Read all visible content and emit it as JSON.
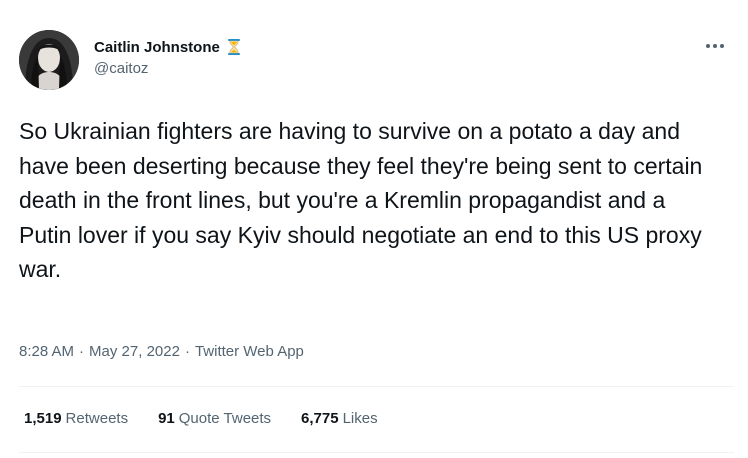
{
  "author": {
    "display_name": "Caitlin Johnstone",
    "handle": "@caitoz",
    "name_emoji": "hourglass-icon"
  },
  "tweet": {
    "text": "So Ukrainian fighters are having to survive on a potato a day and have been deserting because they feel they're being sent to certain death in the front lines, but you're a Kremlin propagandist and a Putin lover if you say Kyiv should negotiate an end to this US proxy war.",
    "time": "8:28 AM",
    "date": "May 27, 2022",
    "source": "Twitter Web App",
    "separator": "·"
  },
  "stats": {
    "retweets_count": "1,519",
    "retweets_label": "Retweets",
    "quote_tweets_count": "91",
    "quote_tweets_label": "Quote Tweets",
    "likes_count": "6,775",
    "likes_label": "Likes"
  },
  "colors": {
    "text_primary": "#0f1419",
    "text_secondary": "#536471",
    "divider": "#eff3f4"
  }
}
